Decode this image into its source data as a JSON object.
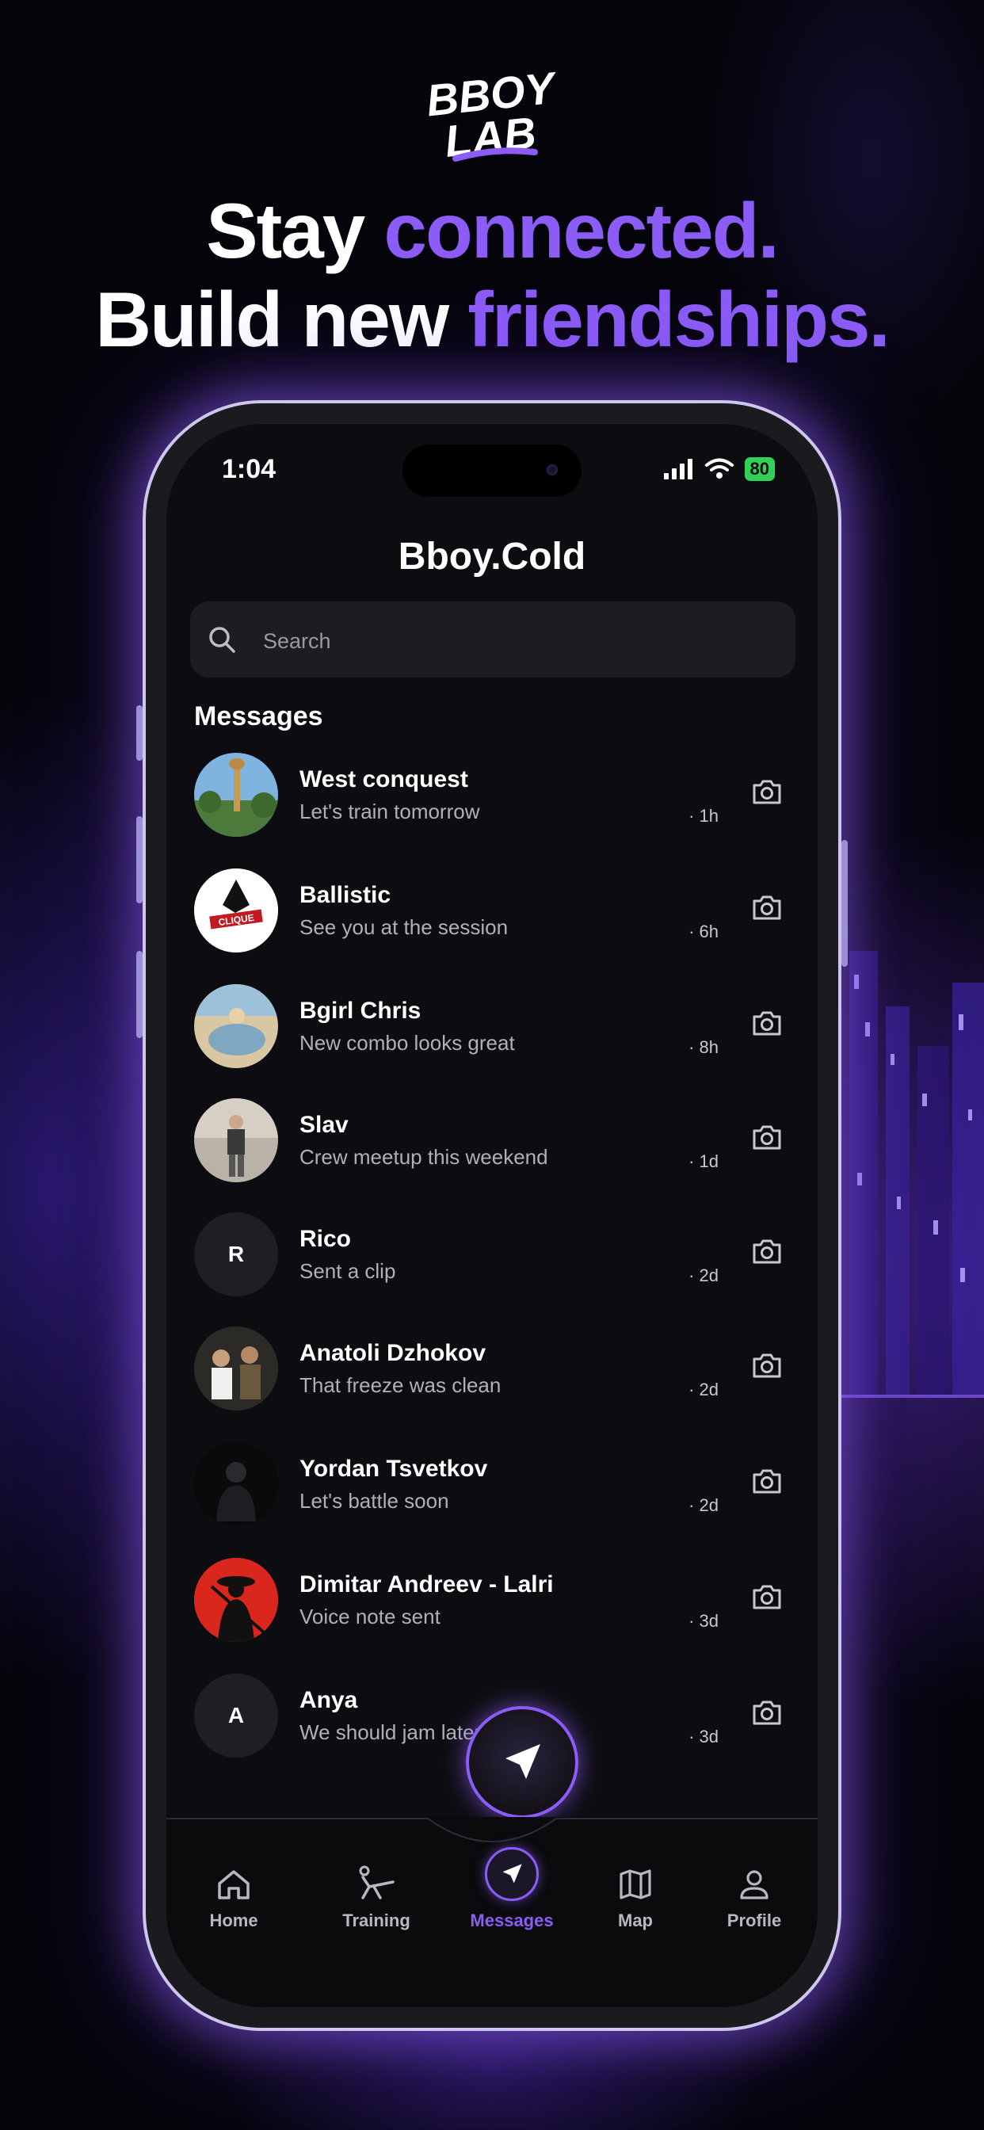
{
  "brand": {
    "logo_line1": "BBOY",
    "logo_line2": "LAB"
  },
  "headline": {
    "line1_plain": "Stay ",
    "line1_accent": "connected.",
    "line2_plain": "Build new ",
    "line2_accent": "friendships."
  },
  "colors": {
    "accent": "#8b5cf6",
    "battery": "#30d158",
    "background": "#05040a"
  },
  "status_bar": {
    "time": "1:04",
    "battery": "80"
  },
  "header": {
    "title": "Bboy.Cold"
  },
  "search": {
    "placeholder": "Search"
  },
  "messages": {
    "section_title": "Messages",
    "items": [
      {
        "name": "West conquest",
        "preview": "Let's train tomorrow",
        "age": "· 1h",
        "avatar": "photo-giraffe"
      },
      {
        "name": "Ballistic",
        "preview": "See you at the session",
        "age": "· 6h",
        "avatar": "logo-clique"
      },
      {
        "name": "Bgirl Chris",
        "preview": "New combo looks great",
        "age": "· 8h",
        "avatar": "photo-beach"
      },
      {
        "name": "Slav",
        "preview": "Crew meetup this weekend",
        "age": "· 1d",
        "avatar": "photo-person"
      },
      {
        "name": "Rico",
        "preview": "Sent a clip",
        "age": "· 2d",
        "avatar_initial": "R"
      },
      {
        "name": "Anatoli Dzhokov",
        "preview": "That freeze was clean",
        "age": "· 2d",
        "avatar": "photo-group"
      },
      {
        "name": "Yordan Tsvetkov",
        "preview": "Let's battle soon",
        "age": "· 2d",
        "avatar": "photo-dark"
      },
      {
        "name": "Dimitar Andreev - Lalri",
        "preview": "Voice note sent",
        "age": "· 3d",
        "avatar": "photo-red"
      },
      {
        "name": "Anya",
        "preview": "We should jam later",
        "age": "· 3d",
        "avatar_initial": "A"
      }
    ]
  },
  "nav": {
    "items": [
      {
        "label": "Home",
        "icon": "home-icon"
      },
      {
        "label": "Training",
        "icon": "training-icon"
      },
      {
        "label": "Messages",
        "icon": "send-icon",
        "active": true
      },
      {
        "label": "Map",
        "icon": "map-icon"
      },
      {
        "label": "Profile",
        "icon": "profile-icon"
      }
    ]
  }
}
